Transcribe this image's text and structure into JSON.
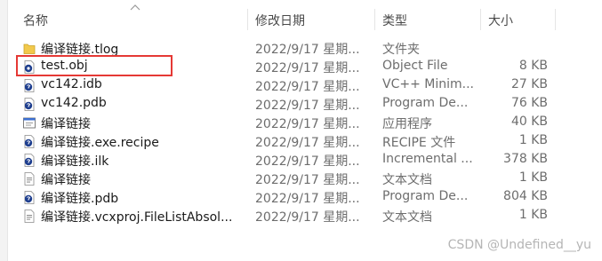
{
  "header": {
    "name": "名称",
    "date": "修改日期",
    "type": "类型",
    "size": "大小"
  },
  "files": [
    {
      "name": "编译链接.tlog",
      "date": "2022/9/17 星期...",
      "type": "文件夹",
      "size": "",
      "icon": "folder-icon"
    },
    {
      "name": "test.obj",
      "date": "2022/9/17 星期...",
      "type": "Object File",
      "size": "8 KB",
      "icon": "object-file-icon"
    },
    {
      "name": "vc142.idb",
      "date": "2022/9/17 星期...",
      "type": "VC++ Minim...",
      "size": "27 KB",
      "icon": "file-icon"
    },
    {
      "name": "vc142.pdb",
      "date": "2022/9/17 星期...",
      "type": "Program De...",
      "size": "76 KB",
      "icon": "file-icon"
    },
    {
      "name": "编译链接",
      "date": "2022/9/17 星期...",
      "type": "应用程序",
      "size": "40 KB",
      "icon": "application-icon"
    },
    {
      "name": "编译链接.exe.recipe",
      "date": "2022/9/17 星期...",
      "type": "RECIPE 文件",
      "size": "1 KB",
      "icon": "file-icon"
    },
    {
      "name": "编译链接.ilk",
      "date": "2022/9/17 星期...",
      "type": "Incremental ...",
      "size": "378 KB",
      "icon": "file-icon"
    },
    {
      "name": "编译链接",
      "date": "2022/9/17 星期...",
      "type": "文本文档",
      "size": "1 KB",
      "icon": "text-file-icon"
    },
    {
      "name": "编译链接.pdb",
      "date": "2022/9/17 星期...",
      "type": "Program De...",
      "size": "804 KB",
      "icon": "file-icon"
    },
    {
      "name": "编译链接.vcxproj.FileListAbsol...",
      "date": "2022/9/17 星期...",
      "type": "文本文档",
      "size": "1 KB",
      "icon": "text-file-icon"
    }
  ],
  "watermark": "CSDN @Undefined__yu",
  "colors": {
    "highlight_border": "#e53935",
    "folder": "#f2c94c",
    "file_badge": "#1f3f8f"
  }
}
